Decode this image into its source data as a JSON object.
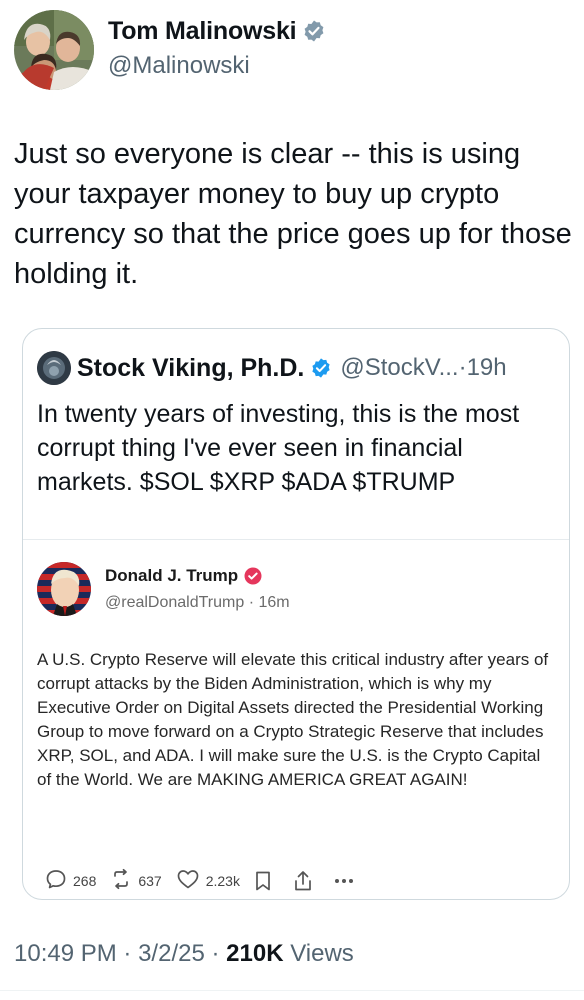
{
  "tweet": {
    "author": {
      "name": "Tom Malinowski",
      "handle": "@Malinowski"
    },
    "text": "Just so everyone is clear -- this is using your taxpayer money to buy up crypto currency so that the price goes up for those holding it.",
    "time": "10:49 PM",
    "date": "3/2/25",
    "views_count": "210K",
    "views_label": "Views",
    "separator": "·"
  },
  "quoted": {
    "author": {
      "name": "Stock Viking, Ph.D.",
      "handle": "@StockV...",
      "age": "19h"
    },
    "separator": "·",
    "text": "In twenty years of investing, this is the most corrupt thing I've ever seen in financial markets. $SOL $XRP $ADA $TRUMP"
  },
  "embedded_post": {
    "author": {
      "name": "Donald J. Trump",
      "handle": "@realDonaldTrump",
      "age": "16m"
    },
    "separator": "·",
    "text": "A U.S. Crypto Reserve will elevate this critical industry after years of corrupt attacks by the Biden Administration, which is why my Executive Order on Digital Assets directed the Presidential Working Group to move forward on a Crypto Strategic Reserve that includes XRP, SOL, and ADA. I will make sure the U.S. is the Crypto Capital of the World. We are MAKING AMERICA GREAT AGAIN!",
    "actions": {
      "replies": "268",
      "retruths": "637",
      "likes": "2.23k"
    }
  },
  "colors": {
    "verified_blue": "#1d9bf0",
    "truth_badge": "#e5365c",
    "muted_text": "#536471",
    "border": "#cfd9de"
  },
  "icons": [
    "verified-badge-icon",
    "reply-icon",
    "retruth-icon",
    "like-icon",
    "bookmark-icon",
    "share-icon",
    "more-icon"
  ]
}
